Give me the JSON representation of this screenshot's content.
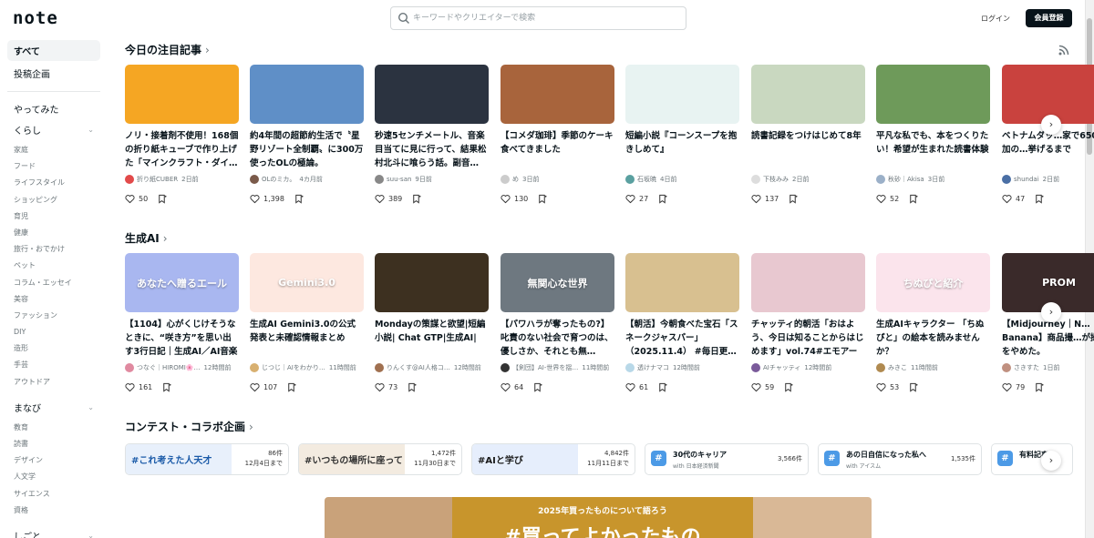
{
  "header": {
    "logo": "note",
    "search_placeholder": "キーワードやクリエイターで検索",
    "login_label": "ログイン",
    "signup_label": "会員登録"
  },
  "sidebar": {
    "top": [
      "すべて",
      "投稿企画"
    ],
    "special": "やってみた",
    "groups": [
      {
        "label": "くらし",
        "items": [
          "家庭",
          "フード",
          "ライフスタイル",
          "ショッピング",
          "育児",
          "健康",
          "旅行・おでかけ",
          "ペット",
          "コラム・エッセイ",
          "美容",
          "ファッション",
          "DIY",
          "造形",
          "手芸",
          "アウトドア"
        ]
      },
      {
        "label": "まなび",
        "items": [
          "教育",
          "読書",
          "デザイン",
          "人文学",
          "サイエンス",
          "資格"
        ]
      },
      {
        "label": "しごと",
        "items": []
      }
    ]
  },
  "sections": {
    "today_title": "今日の注目記事",
    "ai_title": "生成AI",
    "contest_title": "コンテスト・コラボ企画"
  },
  "today_cards": [
    {
      "title": "ノリ・接着剤不使用！168個の折り紙キューブで作り上げた「マインクラフト・ダイ…",
      "author": "折り紙CUBER",
      "time": "2日前",
      "likes": "50",
      "thumb": "#f5a623",
      "avatar": "#e24a4a"
    },
    {
      "title": "約4年間の超節約生活で〝星野リゾート全制覇〟に300万使ったOLの極論。",
      "author": "OLのミカ。",
      "time": "4カ月前",
      "likes": "1,398",
      "thumb": "#5f8fc7",
      "avatar": "#7a5a4a"
    },
    {
      "title": "秒速5センチメートル、音楽目当てに見に行って、結果松村北斗に喰らう話。副音…",
      "author": "suu-san",
      "time": "9日前",
      "likes": "389",
      "thumb": "#2b3340",
      "avatar": "#888888"
    },
    {
      "title": "【コメダ珈琲】季節のケーキ食べてきました",
      "author": "め",
      "time": "3日前",
      "likes": "130",
      "thumb": "#a8643c",
      "avatar": "#cccccc"
    },
    {
      "title": "短編小説『コーンスープを抱きしめて』",
      "author": "石坂暁",
      "time": "4日前",
      "likes": "27",
      "thumb": "#e8f3f2",
      "avatar": "#5aa0a0"
    },
    {
      "title": "読書記録をつけはじめて8年",
      "author": "下枝みみ",
      "time": "2日前",
      "likes": "137",
      "thumb": "#c9d8c0",
      "avatar": "#dddddd"
    },
    {
      "title": "平凡な私でも、本をつくりたい！希望が生まれた読書体験",
      "author": "秋砂｜Akisa",
      "time": "3日前",
      "likes": "52",
      "thumb": "#6e9a5a",
      "avatar": "#9bb0c8"
    },
    {
      "title": "ベトナムダッ…家で650人参加の…挙げるまで",
      "author": "shundai",
      "time": "2日前",
      "likes": "47",
      "thumb": "#c9423e",
      "avatar": "#4a6fa5"
    }
  ],
  "ai_cards": [
    {
      "title": "【1104】心がくじけそうなときに、“咲き方”を思い出す3行日記｜生成AI／AI音楽／…",
      "author": "つなぐ｜HIROMI🌸…",
      "time": "12時間前",
      "likes": "161",
      "thumb": "#a9b7f0",
      "thumb_text": "あなたへ贈るエール",
      "avatar": "#e08aa0"
    },
    {
      "title": "生成AI Gemini3.0の公式発表と未確認情報まとめ",
      "author": "じつじ｜AIをわかり…",
      "time": "11時間前",
      "likes": "107",
      "thumb": "#fde8e0",
      "thumb_text": "Gemini3.0",
      "avatar": "#d8b070"
    },
    {
      "title": "Mondayの策謀と欲望|短編小説| Chat GTP|生成AI|",
      "author": "りんくす@AI人格コ…",
      "time": "12時間前",
      "likes": "73",
      "thumb": "#3d3020",
      "thumb_text": "",
      "avatar": "#a07050"
    },
    {
      "title": "【パワハラが奪ったもの?】叱責のない社会で育つのは、優しさか、それとも無…",
      "author": "【剣団】AI-世界を揺…",
      "time": "11時間前",
      "likes": "64",
      "thumb": "#6e7880",
      "thumb_text": "無関心な世界",
      "avatar": "#333333"
    },
    {
      "title": "【朝活】今朝食べた宝石「スネークジャスパー」（2025.11.4） #毎日更…",
      "author": "透けナマコ",
      "time": "12時間前",
      "likes": "61",
      "thumb": "#d8c090",
      "thumb_text": "",
      "avatar": "#b8d8e8"
    },
    {
      "title": "チャッティ的朝活「おはよう、今日は知ることからはじめます」vol.74#エモアート…",
      "author": "AIチャッティ",
      "time": "12時間前",
      "likes": "59",
      "thumb": "#e8c8d0",
      "thumb_text": "",
      "avatar": "#7a5a9a"
    },
    {
      "title": "生成AIキャラクター 「ちぬぴと」の絵本を読みませんか？",
      "author": "みきこ",
      "time": "11時間前",
      "likes": "53",
      "thumb": "#fbe4ec",
      "thumb_text": "ちぬぴと紹介",
      "avatar": "#b08a50"
    },
    {
      "title": "【Midjourney｜N…Banana】商品撮…が撮影をやめた。",
      "author": "さきすた",
      "time": "1日前",
      "likes": "79",
      "thumb": "#3a2a2a",
      "thumb_text": "PROM",
      "avatar": "#c09080"
    }
  ],
  "contests": [
    {
      "count": "86件",
      "deadline": "12月4日まで",
      "label": "#これ考えた人天才",
      "color": "#1a5aa8",
      "bg": "#e8f0fb"
    },
    {
      "count": "1,472件",
      "deadline": "11月30日まで",
      "label": "#いつもの場所に座って",
      "color": "#333333",
      "bg": "#f3ebe0"
    },
    {
      "count": "4,842件",
      "deadline": "11月11日まで",
      "label": "#AIと学び",
      "color": "#1a1a1a",
      "bg": "#e6eefc"
    },
    {
      "count": "3,566件",
      "label": "30代のキャリア",
      "sub": "with 日本経済新聞"
    },
    {
      "count": "1,535件",
      "label": "あの日自信になった私へ",
      "sub": "with アイスム"
    },
    {
      "count": "",
      "label": "有料記事",
      "sub": ""
    }
  ],
  "banner": {
    "top_text": "2025年買ったものについて語ろう",
    "big_text": "#買ってよかったもの"
  },
  "colors": {
    "text": "#08131a",
    "muted": "#6b757a",
    "accent_dark": "#08131a",
    "hashtag_blue": "#4c9ae6"
  }
}
